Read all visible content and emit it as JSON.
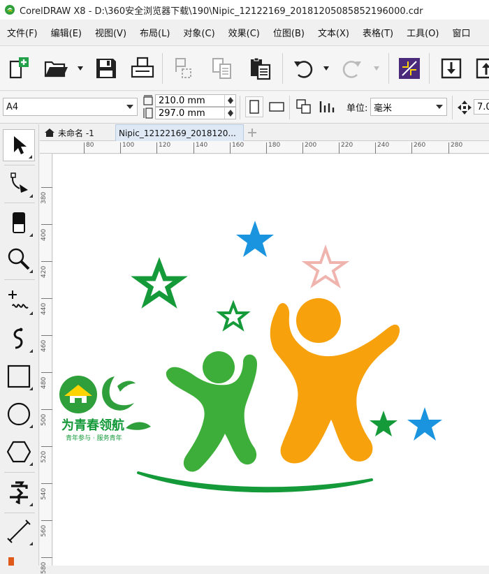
{
  "window": {
    "title": "CorelDRAW X8 - D:\\360安全浏览器下载\\190\\Nipic_12122169_20181205085852196000.cdr"
  },
  "menu": [
    "文件(F)",
    "编辑(E)",
    "视图(V)",
    "布局(L)",
    "对象(C)",
    "效果(C)",
    "位图(B)",
    "文本(X)",
    "表格(T)",
    "工具(O)",
    "窗口"
  ],
  "toolbar": {
    "icons": [
      "new-document-icon",
      "open-folder-icon",
      "save-icon",
      "print-icon",
      "cut-icon",
      "copy-icon",
      "paste-icon",
      "undo-icon",
      "redo-icon",
      "import-icon",
      "export-icon"
    ]
  },
  "propbar": {
    "page_size": "A4",
    "width": "210.0 mm",
    "height": "297.0 mm",
    "unit_label": "单位:",
    "unit_value": "毫米",
    "nudge_value": "7.0"
  },
  "tabs": {
    "home_label": "未命名 -1",
    "active_label": "Nipic_12122169_2018120..."
  },
  "ruler": {
    "h_labels": [
      "80",
      "100",
      "120",
      "140",
      "160",
      "180",
      "200",
      "220",
      "240",
      "260",
      "280"
    ],
    "v_labels": [
      "380",
      "400",
      "420",
      "440",
      "460",
      "480",
      "500",
      "520",
      "540",
      "560",
      "580"
    ]
  },
  "artwork": {
    "logo_title": "为青春领航",
    "logo_subtitle": "青年参与 · 服务青年",
    "colors": {
      "orange": "#f7a10c",
      "green": "#3dae3a",
      "dark_green": "#159a3a",
      "blue": "#1a94de",
      "pink": "#f0b4ae"
    }
  }
}
